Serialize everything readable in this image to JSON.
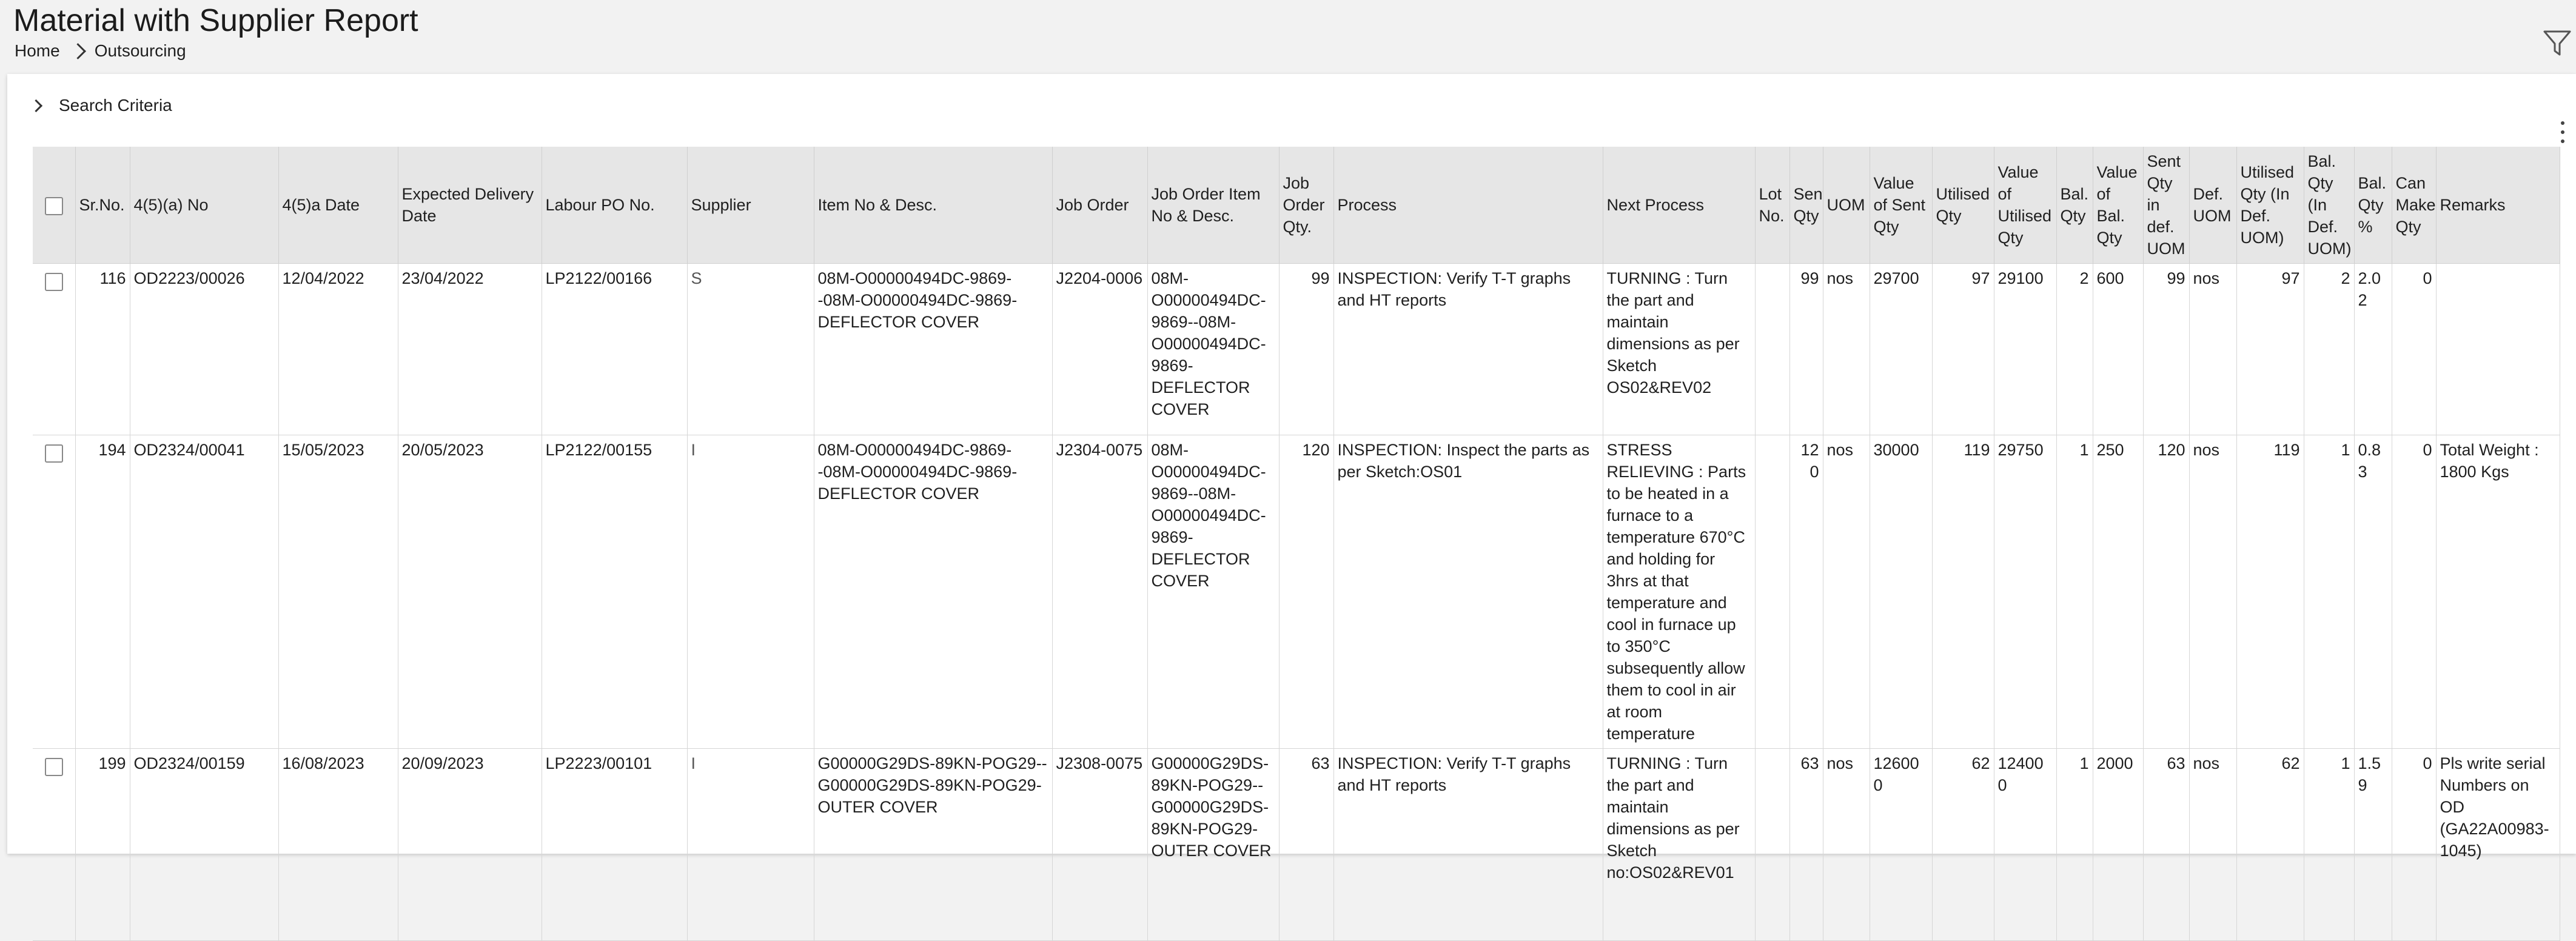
{
  "page": {
    "title": "Material with Supplier Report",
    "breadcrumb": [
      "Home",
      "Outsourcing"
    ],
    "search_criteria_label": "Search Criteria"
  },
  "columns": [
    "Sr.No.",
    "4(5)(a) No",
    "4(5)a Date",
    "Expected Delivery Date",
    "Labour PO No.",
    "Supplier",
    "Item No & Desc.",
    "Job Order",
    "Job Order Item No & Desc.",
    "Job Order Qty.",
    "Process",
    "Next Process",
    "Lot No.",
    "Sent Qty",
    "UOM",
    "Value of Sent Qty",
    "Utilised Qty",
    "Value of Utilised Qty",
    "Bal. Qty",
    "Value of Bal. Qty",
    "Sent Qty in def. UOM",
    "Def. UOM",
    "Utilised Qty (In Def. UOM)",
    "Bal. Qty (In Def. UOM)",
    "Bal. Qty %",
    "Can Make Qty",
    "Remarks"
  ],
  "rows": [
    {
      "sr_no": "116",
      "a_no": "OD2223/00026",
      "a_date": "12/04/2022",
      "expected_delivery": "23/04/2022",
      "labour_po": "LP2122/00166",
      "supplier": "S",
      "item": "08M-O00000494DC-9869--08M-O00000494DC-9869-DEFLECTOR COVER",
      "job_order": "J2204-0006",
      "job_order_item": "08M-O00000494DC-9869--08M-O00000494DC-9869-DEFLECTOR COVER",
      "job_order_qty": "99",
      "process": "INSPECTION: Verify T-T graphs and HT reports",
      "next_process": "TURNING : Turn the part and maintain dimensions as per Sketch OS02&REV02",
      "lot_no": "",
      "sent_qty": "99",
      "uom": "nos",
      "value_sent": "29700",
      "utilised_qty": "97",
      "value_utilised": "29100",
      "bal_qty": "2",
      "value_bal": "600",
      "sent_def": "99",
      "def_uom": "nos",
      "utilised_def": "97",
      "bal_def": "2",
      "bal_pct": "2.02",
      "can_make": "0",
      "remarks": ""
    },
    {
      "sr_no": "194",
      "a_no": "OD2324/00041",
      "a_date": "15/05/2023",
      "expected_delivery": "20/05/2023",
      "labour_po": "LP2122/00155",
      "supplier": "I",
      "item": "08M-O00000494DC-9869--08M-O00000494DC-9869-DEFLECTOR COVER",
      "job_order": "J2304-0075",
      "job_order_item": "08M-O00000494DC-9869--08M-O00000494DC-9869-DEFLECTOR COVER",
      "job_order_qty": "120",
      "process": "INSPECTION: Inspect the parts as per Sketch:OS01",
      "next_process": "STRESS RELIEVING : Parts to be heated in a furnace to a temperature 670°C and holding for 3hrs at that temperature and cool in furnace up to 350°C subsequently allow them to cool in air at room temperature",
      "lot_no": "",
      "sent_qty": "120",
      "uom": "nos",
      "value_sent": "30000",
      "utilised_qty": "119",
      "value_utilised": "29750",
      "bal_qty": "1",
      "value_bal": "250",
      "sent_def": "120",
      "def_uom": "nos",
      "utilised_def": "119",
      "bal_def": "1",
      "bal_pct": "0.83",
      "can_make": "0",
      "remarks": "Total Weight : 1800 Kgs"
    },
    {
      "sr_no": "199",
      "a_no": "OD2324/00159",
      "a_date": "16/08/2023",
      "expected_delivery": "20/09/2023",
      "labour_po": "LP2223/00101",
      "supplier": "I",
      "item": "G00000G29DS-89KN-POG29--G00000G29DS-89KN-POG29-OUTER COVER",
      "job_order": "J2308-0075",
      "job_order_item": "G00000G29DS-89KN-POG29--G00000G29DS-89KN-POG29-OUTER COVER",
      "job_order_qty": "63",
      "process": "INSPECTION: Verify T-T graphs and HT reports",
      "next_process": "TURNING : Turn the part and maintain dimensions as per Sketch no:OS02&REV01",
      "lot_no": "",
      "sent_qty": "63",
      "uom": "nos",
      "value_sent": "126000",
      "utilised_qty": "62",
      "value_utilised": "124000",
      "bal_qty": "1",
      "value_bal": "2000",
      "sent_def": "63",
      "def_uom": "nos",
      "utilised_def": "62",
      "bal_def": "1",
      "bal_pct": "1.59",
      "can_make": "0",
      "remarks": "Pls write serial Numbers on OD (GA22A00983-1045)"
    }
  ]
}
